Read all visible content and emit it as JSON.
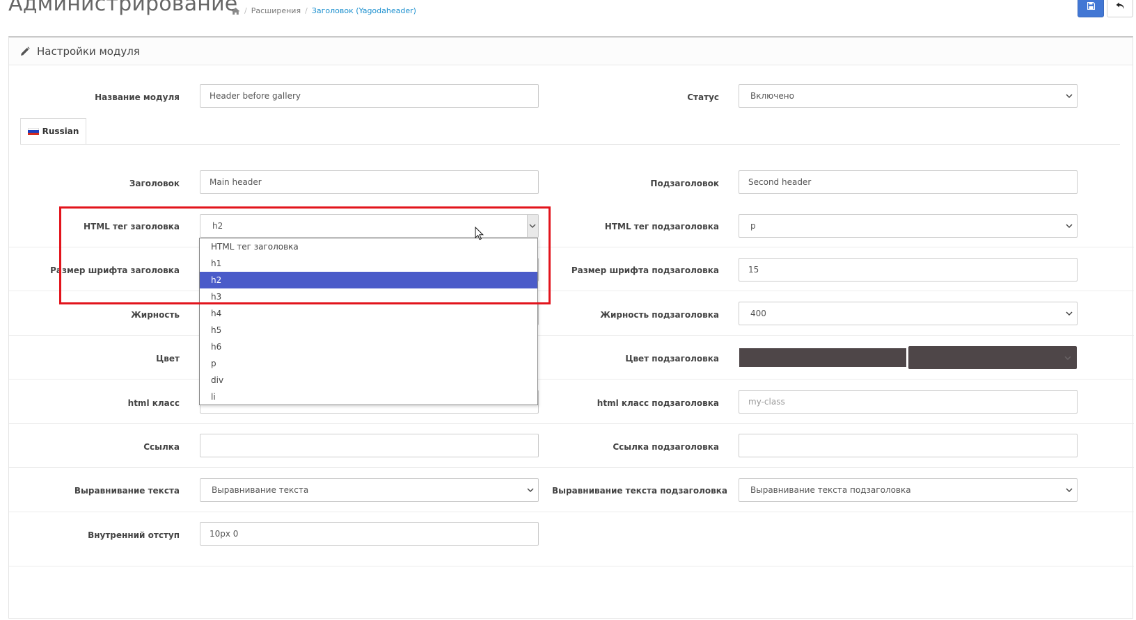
{
  "header": {
    "title": "Администрирование",
    "breadcrumb": [
      "Расширения",
      "Заголовок (Yagodaheader)"
    ]
  },
  "panel": {
    "title": "Настройки модуля"
  },
  "colors": {
    "primary": "#4277d4",
    "highlight_border": "#e2141c",
    "dropdown_selected": "#4a5bc9",
    "color_swatch": "#4e4648"
  },
  "form": {
    "module_name": {
      "label": "Название модуля",
      "value": "Header before gallery"
    },
    "status": {
      "label": "Статус",
      "value": "Включено"
    },
    "tab": {
      "label": "Russian"
    },
    "heading": {
      "label": "Заголовок",
      "value": "Main header"
    },
    "subheading": {
      "label": "Подзаголовок",
      "value": "Second header"
    },
    "heading_tag": {
      "label": "HTML тег заголовка",
      "value": "h2"
    },
    "subheading_tag": {
      "label": "HTML тег подзаголовка",
      "value": "p"
    },
    "heading_font_size": {
      "label": "Размер шрифта заголовка"
    },
    "subheading_font_size": {
      "label": "Размер шрифта подзаголовка",
      "value": "15"
    },
    "weight": {
      "label": "Жирность"
    },
    "subheading_weight": {
      "label": "Жирность подзаголовка",
      "value": "400"
    },
    "color": {
      "label": "Цвет"
    },
    "subheading_color": {
      "label": "Цвет подзаголовка"
    },
    "html_class": {
      "label": "html класс"
    },
    "subheading_html_class": {
      "label": "html класс подзаголовка",
      "placeholder": "my-class"
    },
    "link": {
      "label": "Ссылка",
      "value": ""
    },
    "subheading_link": {
      "label": "Ссылка подзаголовка",
      "value": ""
    },
    "text_align": {
      "label": "Выравнивание текста",
      "value": "Выравнивание текста"
    },
    "subheading_text_align": {
      "label": "Выравнивание текста подзаголовка",
      "value": "Выравнивание текста подзаголовка"
    },
    "padding": {
      "label": "Внутренний отступ",
      "value": "10px 0"
    }
  },
  "dropdown": {
    "options": [
      "HTML тег заголовка",
      "h1",
      "h2",
      "h3",
      "h4",
      "h5",
      "h6",
      "p",
      "div",
      "li"
    ],
    "selected": "h2"
  }
}
